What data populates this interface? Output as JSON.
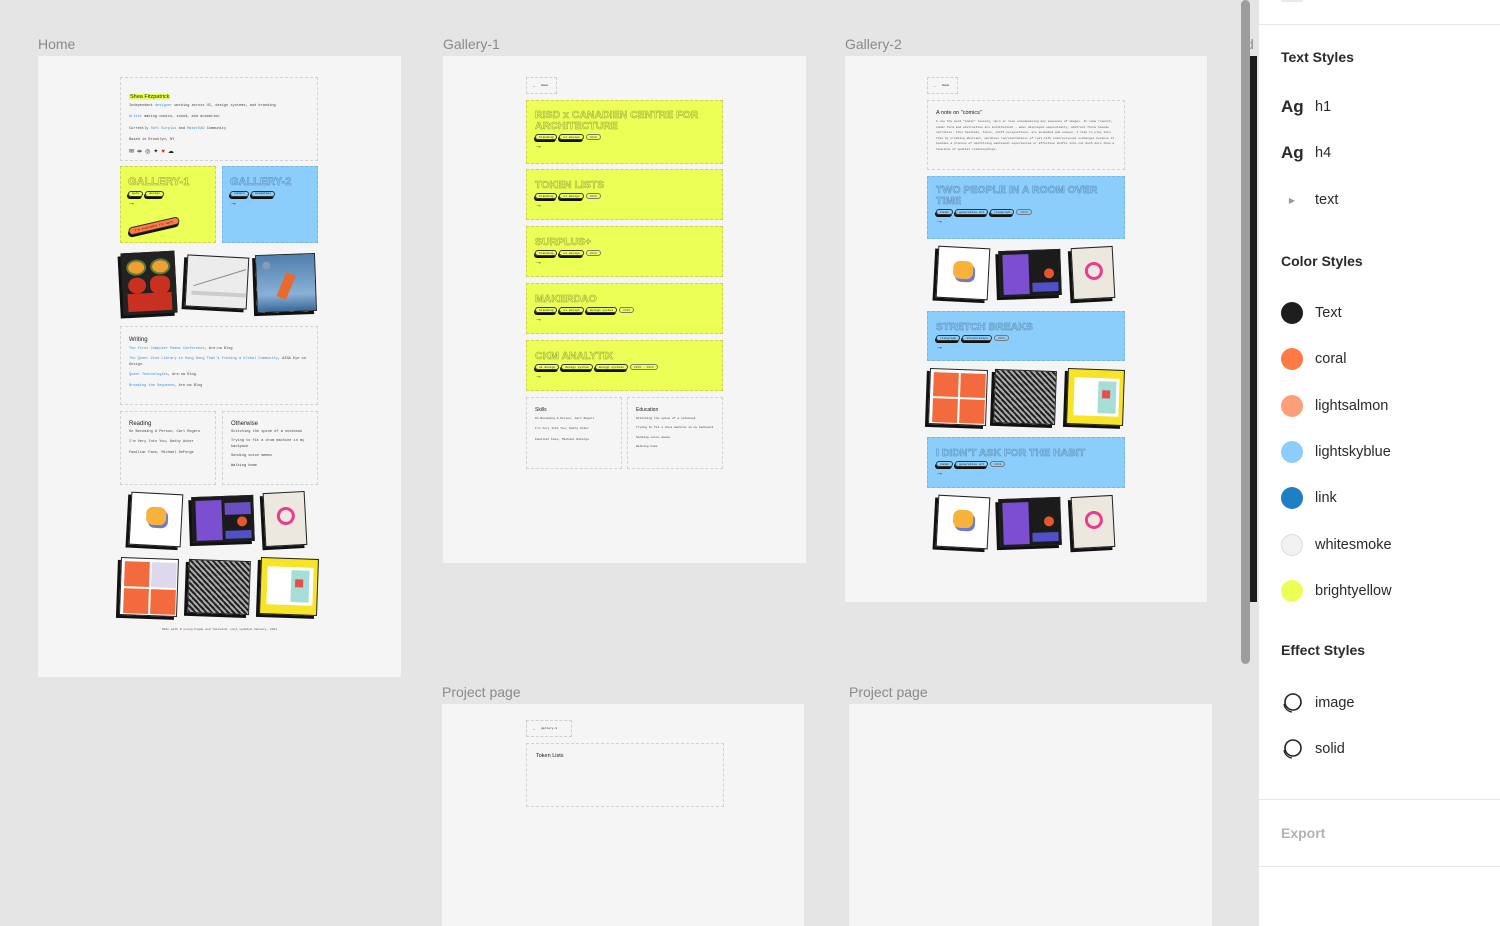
{
  "frames": {
    "home": {
      "label": "Home",
      "intro": {
        "name": "Shea Fitzpatrick",
        "line1_prefix": "Independent ",
        "line1_link": "designer",
        "line1_suffix": " working across UI, design systems, and branding",
        "line2_link": "Artist",
        "line2_suffix": " making comics, sound, and animation",
        "line3_prefix": "Currently ",
        "line3_link1": "Soft Surplus",
        "line3_mid": " and ",
        "line3_link2": "MakerDAO",
        "line3_suffix": " Community",
        "line4": "Based in Brooklyn, NY",
        "social_icons": [
          "mail-icon",
          "link-icon",
          "instagram-icon",
          "twitter-icon",
          "heart-icon",
          "cloud-icon"
        ]
      },
      "gallery_cards": [
        {
          "title": "GALLERY-1",
          "tags": [
            "work",
            "design"
          ],
          "arrow": "→",
          "badge": "I'm available for work"
        },
        {
          "title": "GALLERY-2",
          "tags": [
            "comics",
            "animation"
          ],
          "arrow": "→"
        }
      ],
      "writing": {
        "heading": "Writing",
        "items": [
          {
            "link": "The First Computer Poems Conference",
            "suffix": ", Are.na Blog"
          },
          {
            "link": "The Queer Zine Library in Hong Kong That's Finding a Global Community",
            "suffix": ", AIGA Eye on Design"
          },
          {
            "link": "Queer Technologies",
            "suffix": ", Are.na Blog"
          },
          {
            "link": "Breaking the Sequence",
            "suffix": ", Are.na Blog"
          }
        ]
      },
      "reading": {
        "heading": "Reading",
        "items": [
          "On Becoming A Person, Carl Rogers",
          "I'm Very Into You, Kathy Acker",
          "Familiar Face, Michael DeForge"
        ]
      },
      "otherwise": {
        "heading": "Otherwise",
        "items": [
          "Stitching the spine of a notebook",
          "Trying to fit a drum machine in my backpack",
          "Sending voice memos",
          "Walking home"
        ]
      },
      "footer": {
        "prefix": "Made with",
        "heart": "♥",
        "suffix": "using Figma and Tailwind. Last updated January, 2021"
      }
    },
    "gallery1": {
      "label": "Gallery-1",
      "back_label": "Home",
      "projects": [
        {
          "title": "RISD x CANADIEN CENTRE FOR ARCHITECTURE",
          "tags": [
            "branding",
            "ui design"
          ],
          "year": "2020"
        },
        {
          "title": "TOKEN LISTS",
          "tags": [
            "branding",
            "ui design"
          ],
          "year": "2020"
        },
        {
          "title": "SURPLUS+",
          "tags": [
            "branding",
            "ui design"
          ],
          "year": "2020"
        },
        {
          "title": "MAKERDAO",
          "tags": [
            "branding",
            "ui design",
            "design system"
          ],
          "year": "2020"
        },
        {
          "title": "CKM ANALYTIX",
          "tags": [
            "ui design",
            "design system",
            "design systems"
          ],
          "year": "2019 - 2020"
        }
      ],
      "arrow": "→",
      "skills": {
        "heading": "Skills",
        "items": [
          "On Becoming A Person, Carl Rogers",
          "I'm Very Into You, Kathy Acker",
          "Familiar Face, Michael DeForge"
        ]
      },
      "education": {
        "heading": "Education",
        "items": [
          "Stitching the spine of a notebook",
          "Trying to fit a drum machine in my backpack",
          "Sending voice memos",
          "Walking home"
        ]
      }
    },
    "gallery2": {
      "label": "Gallery-2",
      "back_label": "Home",
      "note": {
        "heading": "A note on \"comics\"",
        "body": "I use the word \"comic\" loosely, more or less encompassing any sequence of images. In some respect, comic form and abstraction are antithetical - when displayed sequentially, abstract forms become narrative: they hesitate, focus, shift perspectives, are animated and unseen. I like to play into this by creating abstract, wordless representations of real-life interpersonal exchanges because it becomes a process of distilling emotional experiences or affective shifts into not much more than a timeline of spatial relationships."
      },
      "projects": [
        {
          "title": "TWO PEOPLE IN A ROOM OVER TIME",
          "tags": [
            "comic",
            "generative art",
            "risograph"
          ],
          "year": "2019"
        },
        {
          "title": "STRETCH BREAKS",
          "tags": [
            "risograph",
            "illustration"
          ],
          "year": "2019"
        },
        {
          "title": "I DIDN'T ASK FOR THE HABIT",
          "tags": [
            "comic",
            "generative art"
          ],
          "year": "2019"
        }
      ],
      "arrow": "→"
    },
    "project_page_1": {
      "label": "Project page",
      "back_label": "gallery-1",
      "title": "Token Lists"
    },
    "project_page_2": {
      "label": "Project page"
    },
    "partial_label": "d"
  },
  "panel": {
    "text_styles": {
      "heading": "Text Styles",
      "items": [
        {
          "sample": "Ag",
          "name": "h1"
        },
        {
          "sample": "Ag",
          "name": "h4"
        },
        {
          "name": "text",
          "collapsed": true
        }
      ]
    },
    "color_styles": {
      "heading": "Color Styles",
      "items": [
        {
          "name": "Text",
          "hex": "#1e1e1e"
        },
        {
          "name": "coral",
          "hex": "#ff7a45"
        },
        {
          "name": "lightsalmon",
          "hex": "#ff9f7a"
        },
        {
          "name": "lightskyblue",
          "hex": "#8ccdfb"
        },
        {
          "name": "link",
          "hex": "#1f7fc4"
        },
        {
          "name": "whitesmoke",
          "hex": "#f2f2f2"
        },
        {
          "name": "brightyellow",
          "hex": "#ebff57"
        }
      ]
    },
    "effect_styles": {
      "heading": "Effect Styles",
      "items": [
        {
          "name": "image"
        },
        {
          "name": "solid"
        }
      ]
    },
    "export_label": "Export"
  }
}
